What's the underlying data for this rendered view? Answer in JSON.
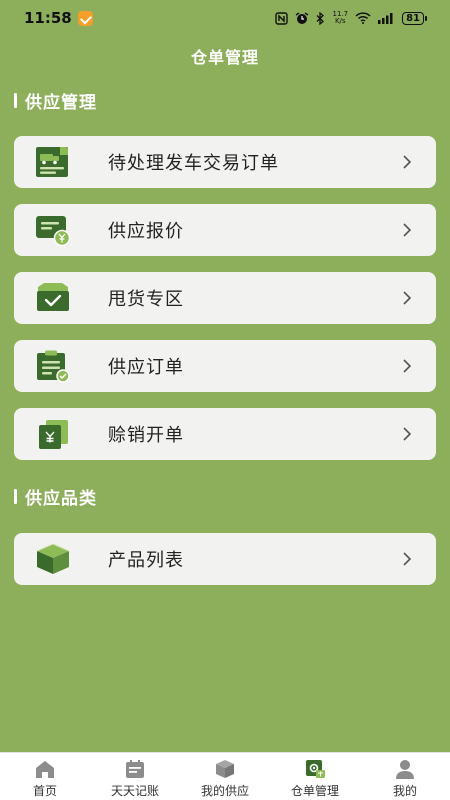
{
  "status_bar": {
    "time": "11:58",
    "net_speed_top": "11.7",
    "net_speed_bottom": "K/s",
    "battery": "81"
  },
  "header": {
    "title": "仓单管理"
  },
  "sections": [
    {
      "title": "供应管理",
      "items": [
        {
          "label": "待处理发车交易订单",
          "icon": "truck-document-icon"
        },
        {
          "label": "供应报价",
          "icon": "quote-yen-icon"
        },
        {
          "label": "甩货专区",
          "icon": "box-check-icon"
        },
        {
          "label": "供应订单",
          "icon": "order-clipboard-icon"
        },
        {
          "label": "赊销开单",
          "icon": "yen-cards-icon"
        }
      ]
    },
    {
      "title": "供应品类",
      "items": [
        {
          "label": "产品列表",
          "icon": "package-box-icon"
        }
      ]
    }
  ],
  "tab_bar": {
    "active_index": 3,
    "tabs": [
      {
        "label": "首页",
        "icon": "home-icon"
      },
      {
        "label": "天天记账",
        "icon": "calendar-icon"
      },
      {
        "label": "我的供应",
        "icon": "box-icon"
      },
      {
        "label": "仓单管理",
        "icon": "warehouse-supply-icon"
      },
      {
        "label": "我的",
        "icon": "user-icon"
      }
    ]
  },
  "colors": {
    "background": "#8daf5c",
    "icon_dark": "#3b6b2c",
    "icon_light": "#8dbb55",
    "card": "#f2f3f0"
  }
}
